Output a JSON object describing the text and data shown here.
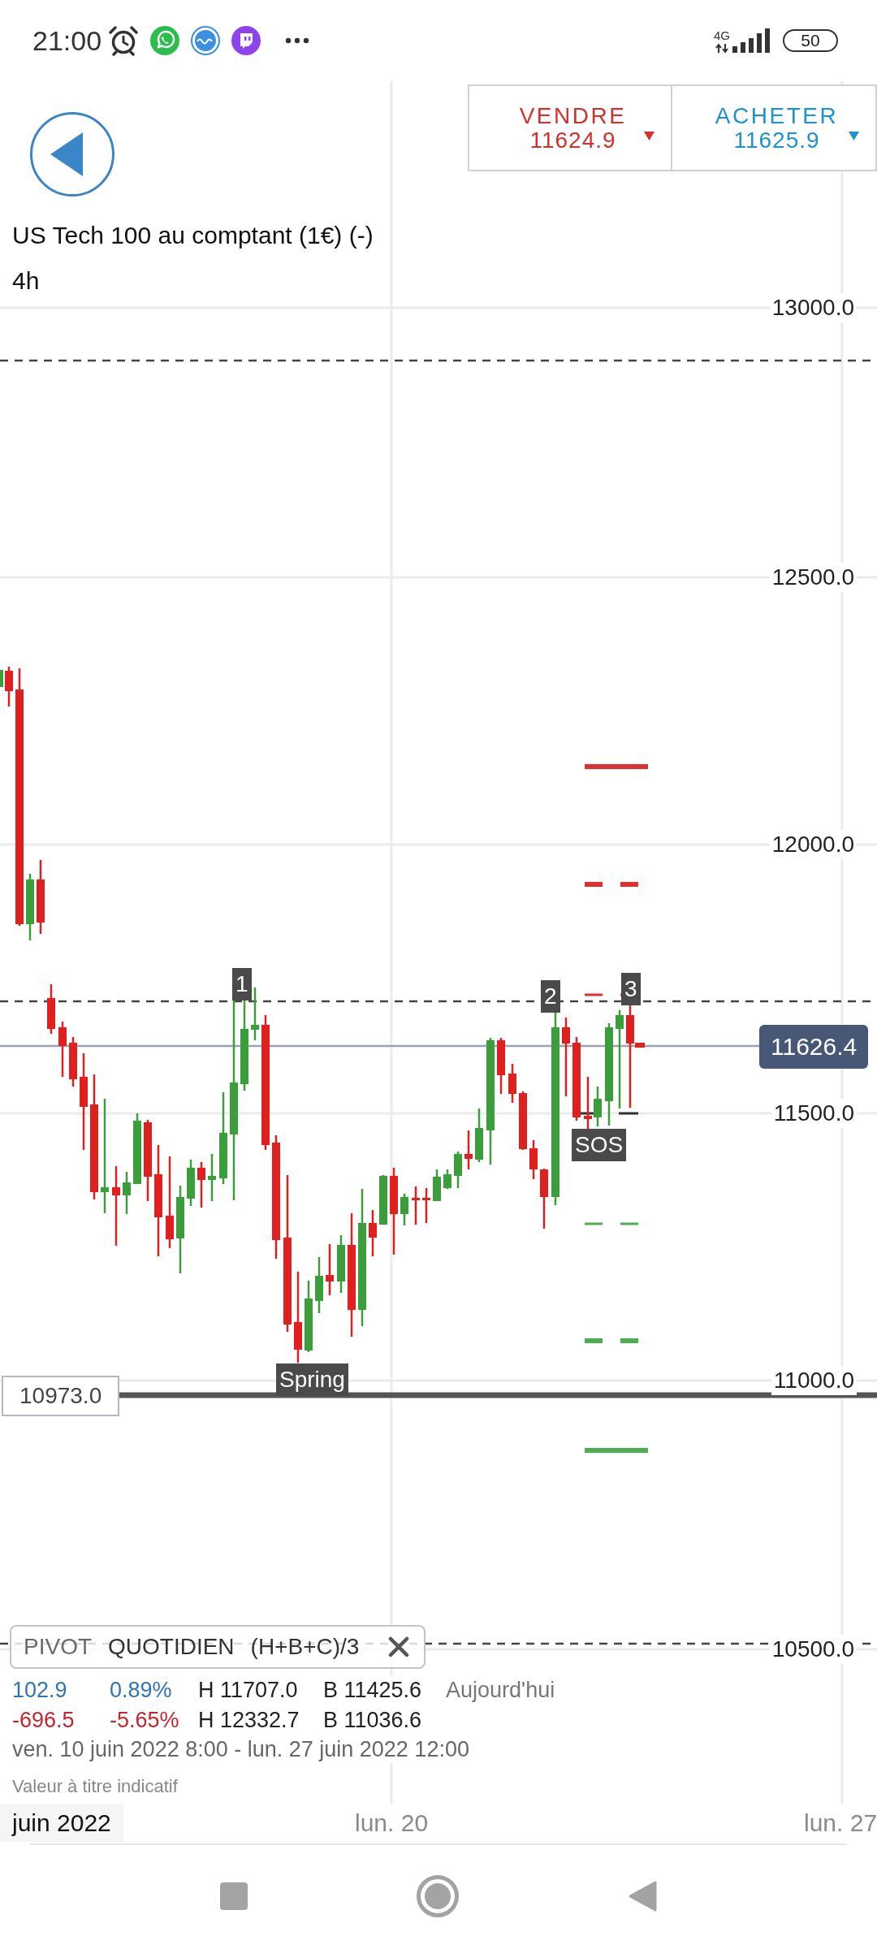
{
  "status_bar": {
    "time": "21:00",
    "network": "4G",
    "battery": "50"
  },
  "header": {
    "title": "US Tech 100 au comptant (1€) (-)",
    "timeframe": "4h"
  },
  "quote": [
    {
      "kind": "sell",
      "label": "VENDRE",
      "price": "11624.9"
    },
    {
      "kind": "buy",
      "label": "ACHETER",
      "price": "11625.9"
    }
  ],
  "chart": {
    "price_axis": [
      "13000.0",
      "12500.0",
      "12000.0",
      "11500.0",
      "11000.0",
      "10500.0"
    ],
    "current_price": "11626.4",
    "level_tag": "10973.0",
    "annotations": [
      "1",
      "Spring",
      "2",
      "SOS",
      "3"
    ]
  },
  "indicator": {
    "name": "PIVOT",
    "period": "QUOTIDIEN",
    "formula": "(H+B+C)/3",
    "rows": [
      {
        "kind": "gain",
        "change": "102.9",
        "percent": "0.89%",
        "high": "H 11707.0",
        "low": "B 11425.6",
        "period": "Aujourd'hui"
      },
      {
        "kind": "loss",
        "change": "-696.5",
        "percent": "-5.65%",
        "high": "H 12332.7",
        "low": "B 11036.6"
      }
    ],
    "range": "ven. 10 juin 2022 8:00 - lun. 27 juin 2022 12:00",
    "note": "Valeur à titre indicatif"
  },
  "time_axis": [
    {
      "kind": "month",
      "label": "juin 2022"
    },
    {
      "kind": "day",
      "label": "lun. 20"
    },
    {
      "kind": "day",
      "label": "lun. 27"
    }
  ]
}
